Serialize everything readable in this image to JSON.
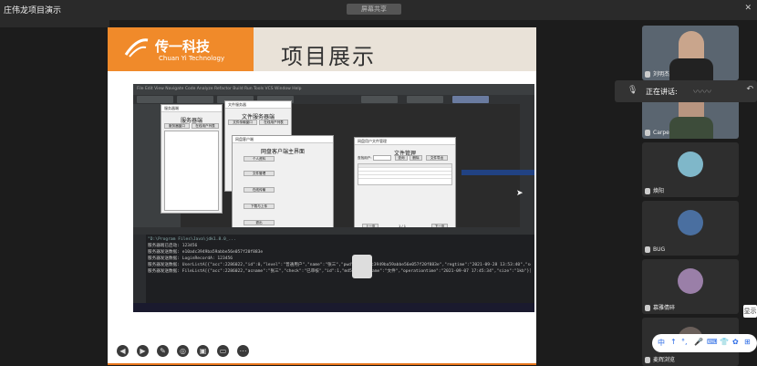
{
  "window": {
    "title": "庄伟龙项目演示",
    "share_pill": "屏幕共享"
  },
  "slide": {
    "logo_cn": "传一科技",
    "logo_en": "Chuan Yi Technology",
    "heading": "项目展示"
  },
  "ide": {
    "menu": "File  Edit  View  Navigate  Code  Analyze  Refactor  Build  Run  Tools  VCS  Window  Help",
    "console_lines": [
      "\"D:\\Program Files\\Java\\jdk1.8.0_...",
      "服务器端已启动: 123456",
      "服务器发送数据: e10adc3949ba59abbe56e057f20f883e",
      "服务器发送数据: LoginRecordA: 123456",
      "服务器发送数据: UserListA[{\"acc\":2286022,\"id\":0,\"level\":\"普通用户\",\"name\":\"张三\",\"pwd\":\"e10adc3949ba59abbe56e057f20f883e\",\"regtime\":\"2021-09-28 13:53:40\",\"sex\":\"男\"}]",
      "服务器发送数据: FileListA[{\"acc\":2286022,\"acname\":\"张三\",\"check\":\"已审核\",\"id\":1,\"md5\":\"1\",\"name\":\"文件\",\"operationtime\":\"2021-09-07 17:45:34\",\"size\":\"1kb\"}]"
    ]
  },
  "dialogs": {
    "server": {
      "title": "服务器端",
      "heading": "服务器端",
      "tab1": "服务器窗口",
      "tab2": "在线用户列表"
    },
    "file_server": {
      "title": "文件服务器",
      "heading": "文件服务器端",
      "tab1": "文件传输窗口",
      "tab2": "在线用户列表"
    },
    "client": {
      "title": "网盘客户端",
      "heading": "网盘客户端主界面",
      "buttons": [
        "个人资料",
        "文件管理",
        "在线传输",
        "下载与上传",
        "退出"
      ]
    },
    "file_manage": {
      "title": "网盘用户文件管理",
      "heading": "文件管理",
      "search_label": "查找用户:",
      "btn_query": "查询",
      "btn_delete": "删除",
      "btn_export": "文件导出",
      "page": "1 / 1",
      "prev": "上一页",
      "next": "下一页"
    }
  },
  "participants": [
    {
      "name": "刘明杰",
      "type": "video"
    },
    {
      "name": "Carpe",
      "type": "video"
    },
    {
      "name": "焕阳",
      "type": "avatar",
      "color": "#7fb7c9"
    },
    {
      "name": "BUG",
      "type": "avatar",
      "color": "#4a6fa0"
    },
    {
      "name": "慕雅倩碎",
      "type": "avatar",
      "color": "#9a7fa8"
    },
    {
      "name": "麦辉浏览",
      "type": "avatar",
      "color": "#6a5f5a"
    }
  ],
  "speaking": {
    "label": "正在讲话:"
  },
  "ime": {
    "items": [
      "中",
      "↑",
      "°,",
      "🎤",
      "⌨",
      "👕",
      "✿",
      "⊞"
    ]
  },
  "hanging_chip": "显示"
}
